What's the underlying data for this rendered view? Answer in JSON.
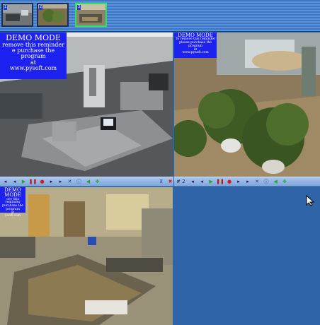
{
  "thumbnails": [
    {
      "label": "1",
      "active": false
    },
    {
      "label": "2",
      "active": false
    },
    {
      "label": "3",
      "active": true
    }
  ],
  "panes": {
    "pane1": {
      "demo_title": "DEMO MODE",
      "demo_line1": "remove this reminder",
      "demo_line2": "e purchase the program",
      "demo_line3": "at",
      "demo_line4": "www.pysoft.com"
    },
    "pane2": {
      "demo_title": "DEMO MODE",
      "demo_line1": "To remove this reminder",
      "demo_line2": "please purchase the program",
      "demo_line3": "at",
      "demo_line4": "www.pysoft.com",
      "camera_label": "# 2"
    },
    "pane3": {
      "demo_title": "DEMO MODE",
      "demo_line1": "ove this reminder",
      "demo_line2": "purchase the program",
      "demo_line3": "at",
      "demo_line4": "ysoft.com"
    }
  },
  "icons": {
    "prev": "step-back-icon",
    "play": "play-icon",
    "pause": "pause-icon",
    "record": "record-icon",
    "next": "step-forward-icon",
    "settings": "tools-icon",
    "info": "info-icon",
    "snapshot": "snapshot-icon",
    "ptz": "ptz-icon",
    "pin": "pin-icon",
    "close": "close-icon"
  },
  "colors": {
    "background": "#2f64a8",
    "demo_bg": "#1e22f0",
    "active_thumb_border": "#2fe15a",
    "record_red": "#e01818",
    "play_green": "#22a82a"
  }
}
